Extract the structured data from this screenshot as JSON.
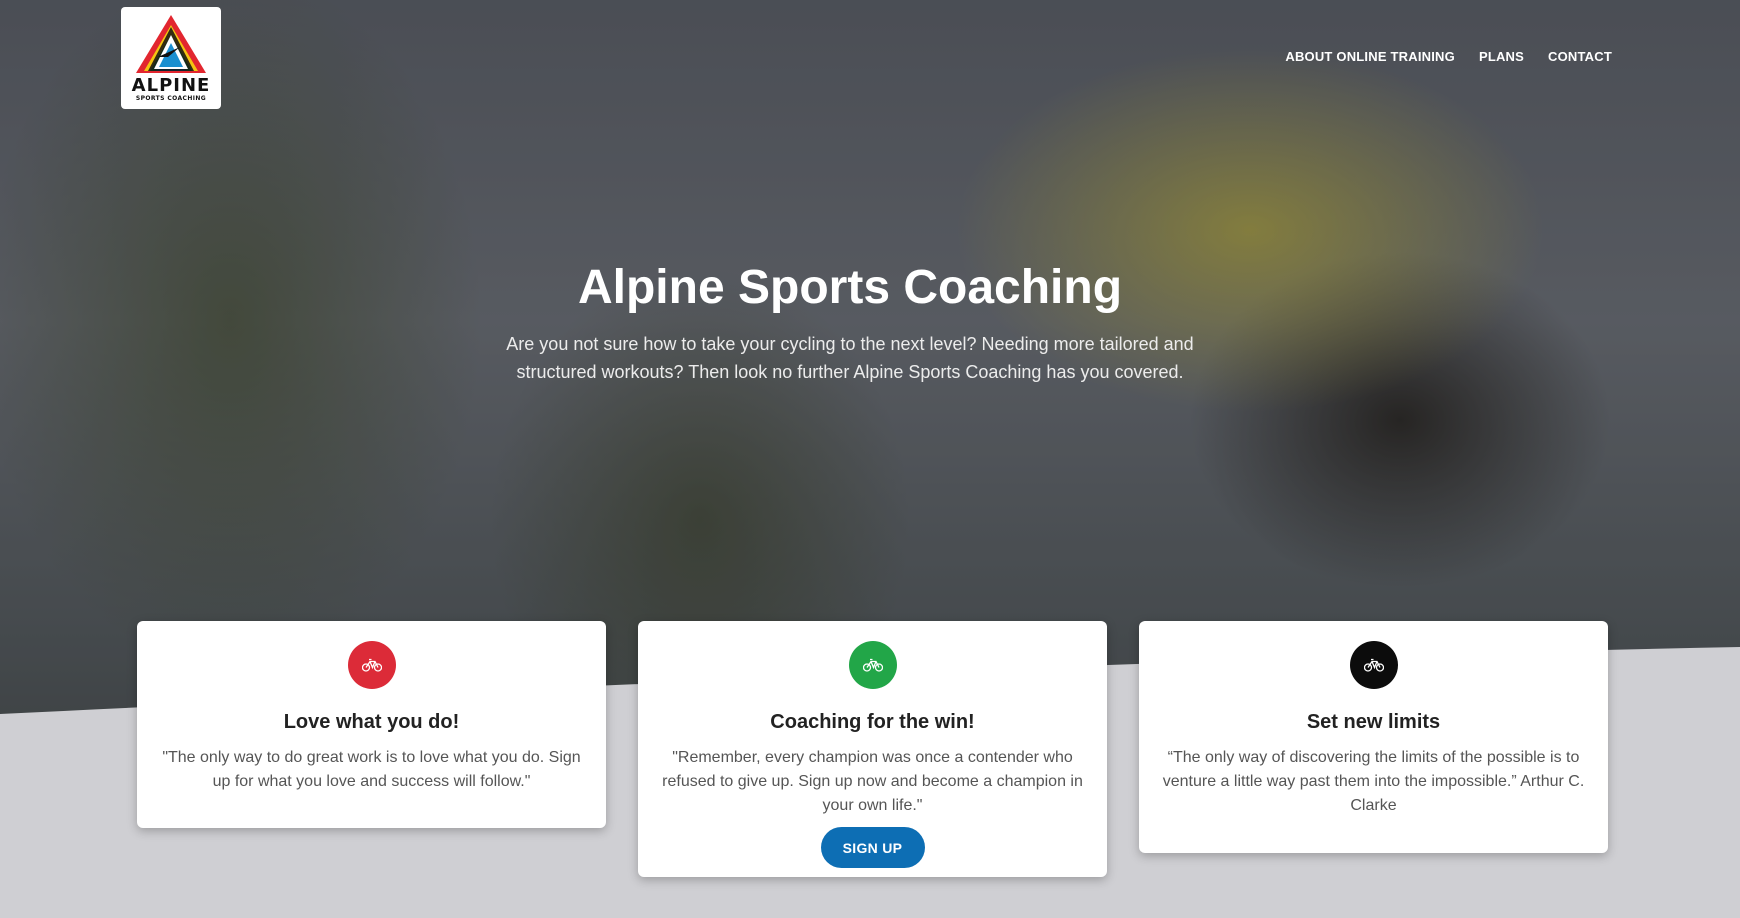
{
  "brand": {
    "logo_word": "ALPINE",
    "logo_sub": "SPORTS COACHING"
  },
  "nav": {
    "items": [
      {
        "label": "ABOUT ONLINE TRAINING"
      },
      {
        "label": "PLANS"
      },
      {
        "label": "CONTACT"
      }
    ]
  },
  "hero": {
    "title": "Alpine Sports Coaching",
    "tagline": "Are you not sure how to take your cycling to the next level? Needing more tailored and structured workouts? Then look no further Alpine Sports Coaching has you covered."
  },
  "cards": [
    {
      "icon": "bicycle-icon",
      "badge_color": "#dc2b38",
      "title": "Love what you do!",
      "text": "\"The only way to do great work is to love what you do. Sign up for what you love and success will follow.\""
    },
    {
      "icon": "bicycle-icon",
      "badge_color": "#22a648",
      "title": "Coaching for the win!",
      "text": "\"Remember, every champion was once a contender who refused to give up. Sign up now and become a champion in your own life.\"",
      "button_label": "SIGN UP"
    },
    {
      "icon": "bicycle-icon",
      "badge_color": "#0c0c0c",
      "title": "Set new limits",
      "text": "“The only way of discovering the limits of the possible is to venture a little way past them into the impossible.” Arthur C. Clarke"
    }
  ],
  "colors": {
    "primary_button": "#0d6eb4",
    "floor": "#cfcfd3"
  }
}
